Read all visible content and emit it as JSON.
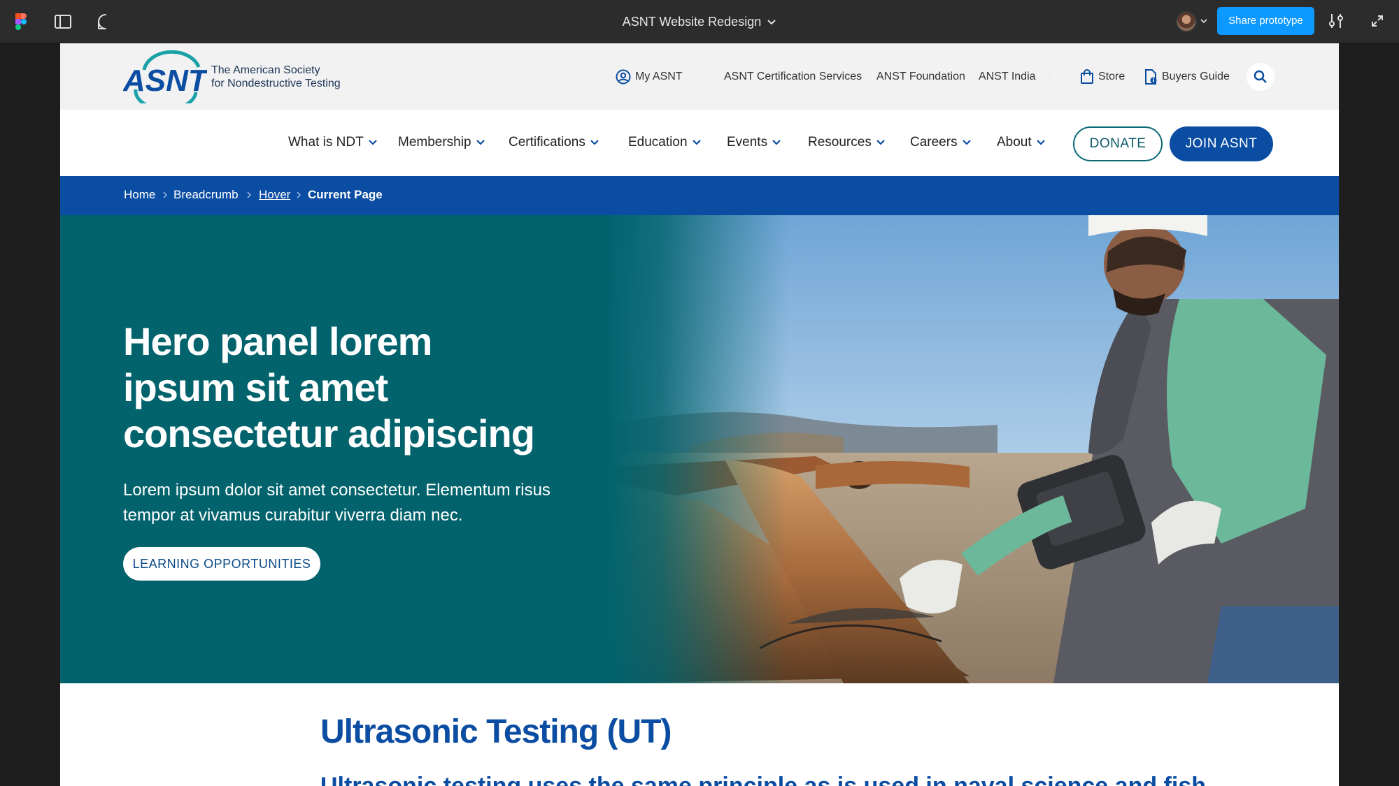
{
  "figma": {
    "file_title": "ASNT Website Redesign",
    "share_label": "Share prototype",
    "icons": [
      "figma-logo-icon",
      "sidebar-toggle-icon",
      "comment-icon",
      "chevron-down-icon",
      "settings-sliders-icon",
      "expand-icon"
    ]
  },
  "site": {
    "logo_text": "ASNT",
    "logo_line1": "The American Society",
    "logo_line2": "for Nondestructive Testing",
    "utility_links": {
      "my_asnt": "My ASNT",
      "certification": "ASNT Certification Services",
      "foundation": "ANST Foundation",
      "india": "ANST India",
      "store": "Store",
      "buyers_guide": "Buyers Guide"
    },
    "nav": {
      "what_is_ndt": "What is NDT",
      "membership": "Membership",
      "certifications": "Certifications",
      "education": "Education",
      "events": "Events",
      "resources": "Resources",
      "careers": "Careers",
      "about": "About"
    },
    "donate": "DONATE",
    "join": "JOIN ASNT",
    "breadcrumb": {
      "home": "Home",
      "breadcrumb": "Breadcrumb",
      "hover": "Hover",
      "current": "Current Page"
    },
    "hero": {
      "title": "Hero panel lorem ipsum sit amet consectetur adipiscing",
      "subtitle": "Lorem ipsum dolor sit amet consectetur. Elementum risus tempor at vivamus curabitur viverra diam nec.",
      "cta": "LEARNING OPPORTUNITIES"
    },
    "section": {
      "title": "Ultrasonic Testing (UT)",
      "subtitle": "Ultrasonic testing uses the same principle as is used in naval science and fish"
    }
  },
  "colors": {
    "brand_blue": "#0b4da2",
    "hero_teal": "#02636d",
    "figma_blue": "#0d99ff",
    "logo_teal": "#1aa2a8"
  }
}
